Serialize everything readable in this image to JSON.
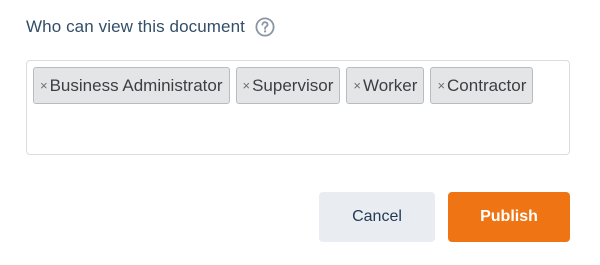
{
  "visibility": {
    "label": "Who can view this document",
    "help_icon": "question-circle-icon",
    "tags": [
      {
        "label": "Business Administrator",
        "remove_glyph": "×"
      },
      {
        "label": "Supervisor",
        "remove_glyph": "×"
      },
      {
        "label": "Worker",
        "remove_glyph": "×"
      },
      {
        "label": "Contractor",
        "remove_glyph": "×"
      }
    ]
  },
  "actions": {
    "cancel_label": "Cancel",
    "publish_label": "Publish"
  },
  "colors": {
    "label_text": "#334e68",
    "tag_background": "#e4e5e7",
    "tag_border": "#b8bcc2",
    "cancel_background": "#e9edf1",
    "publish_background": "#ef7514",
    "publish_text": "#ffffff"
  }
}
